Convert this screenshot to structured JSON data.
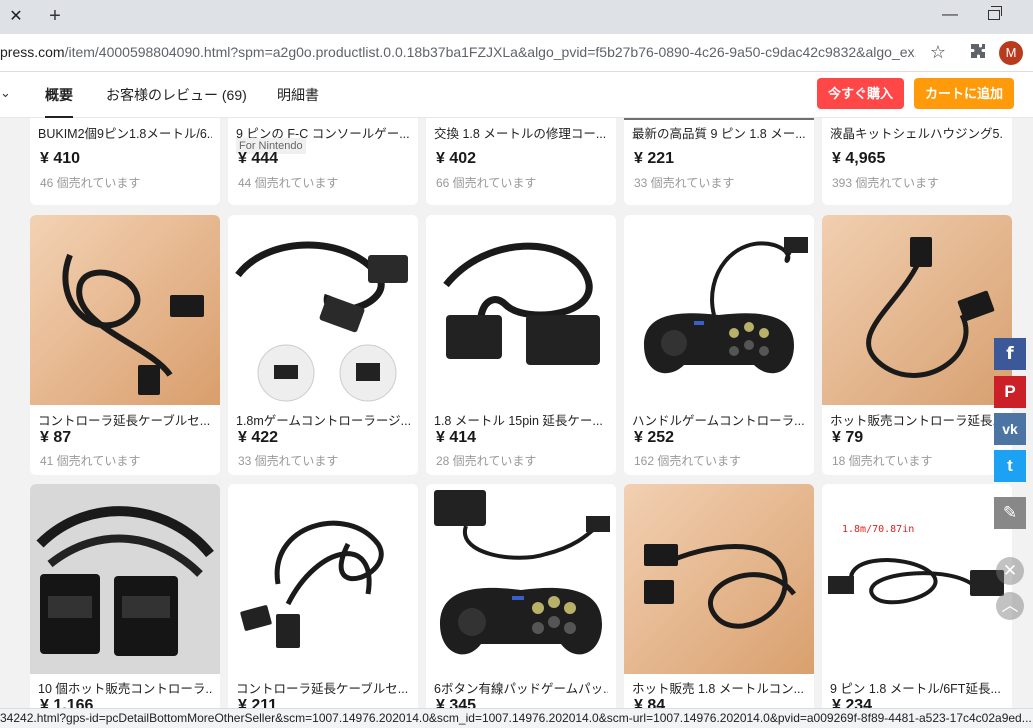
{
  "browser": {
    "tab_close": "✕",
    "new_tab": "+",
    "minimize": "—",
    "url_host": "press.com",
    "url_path": "/item/4000598804090.html?spm=a2g0o.productlist.0.0.18b37ba1FZJXLa&algo_pvid=f5b27b76-0890-4c26-9a50-c9dac42c9832&algo_ex...",
    "avatar_letter": "M",
    "status_url": "34242.html?gps-id=pcDetailBottomMoreOtherSeller&scm=1007.14976.202014.0&scm_id=1007.14976.202014.0&scm-url=1007.14976.202014.0&pvid=a009269f-8f89-4481-a523-17c4c02a9ed..."
  },
  "nav": {
    "tabs": [
      {
        "label": "概要"
      },
      {
        "label": "お客様のレビュー (69)"
      },
      {
        "label": "明細書"
      }
    ],
    "buy_now": "今すぐ購入",
    "add_to_cart": "カートに追加"
  },
  "products": {
    "row1": [
      {
        "title": "BUKIM2個9ピン1.8メートル/6...",
        "price": "¥ 410",
        "sold": "46 個売れています"
      },
      {
        "title": "9 ピンの F-C コンソールゲー...",
        "badge": "For Nintendo",
        "price": "¥ 444",
        "sold": "44 個売れています"
      },
      {
        "title": "交換 1.8 メートルの修理コー...",
        "price": "¥ 402",
        "sold": "66 個売れています"
      },
      {
        "title": "最新の高品質 9 ピン 1.8 メー...",
        "price": "¥ 221",
        "sold": "33 個売れています"
      },
      {
        "title": "液晶キットシェルハウジング5...",
        "price": "¥ 4,965",
        "sold": "393 個売れています"
      }
    ],
    "row2": [
      {
        "title": "コントローラ延長ケーブルセ...",
        "price": "¥ 87",
        "sold": "41 個売れています"
      },
      {
        "title": "1.8mゲームコントローラージ...",
        "price": "¥ 422",
        "sold": "33 個売れています"
      },
      {
        "title": "1.8 メートル 15pin 延長ケー...",
        "price": "¥ 414",
        "sold": "28 個売れています"
      },
      {
        "title": "ハンドルゲームコントローラ...",
        "price": "¥ 252",
        "sold": "162 個売れています"
      },
      {
        "title": "ホット販売コントローラ延長...",
        "price": "¥ 79",
        "sold": "18 個売れています"
      }
    ],
    "row3": [
      {
        "title": "10 個ホット販売コントローラ...",
        "price": "¥ 1,166"
      },
      {
        "title": "コントローラ延長ケーブルセ...",
        "price": "¥ 211"
      },
      {
        "title": "6ボタン有線パッドゲームパッ...",
        "price": "¥ 345"
      },
      {
        "title": "ホット販売 1.8 メートルコン...",
        "price": "¥ 84"
      },
      {
        "title": "9 ピン 1.8 メートル/6FT延長...",
        "price": "¥ 234",
        "image_caption": "1.8m/70.87in"
      }
    ]
  },
  "share": {
    "facebook": "f",
    "pinterest": "P",
    "vk": "vk",
    "twitter": "t",
    "edit": "✎",
    "close": "✕",
    "top": "︿"
  },
  "colors": {
    "buy_now": "#ff4747",
    "add_to_cart": "#ff9b0a",
    "facebook": "#3b5998",
    "pinterest": "#cb2027",
    "vk": "#4c75a3",
    "twitter": "#1da1f2"
  }
}
